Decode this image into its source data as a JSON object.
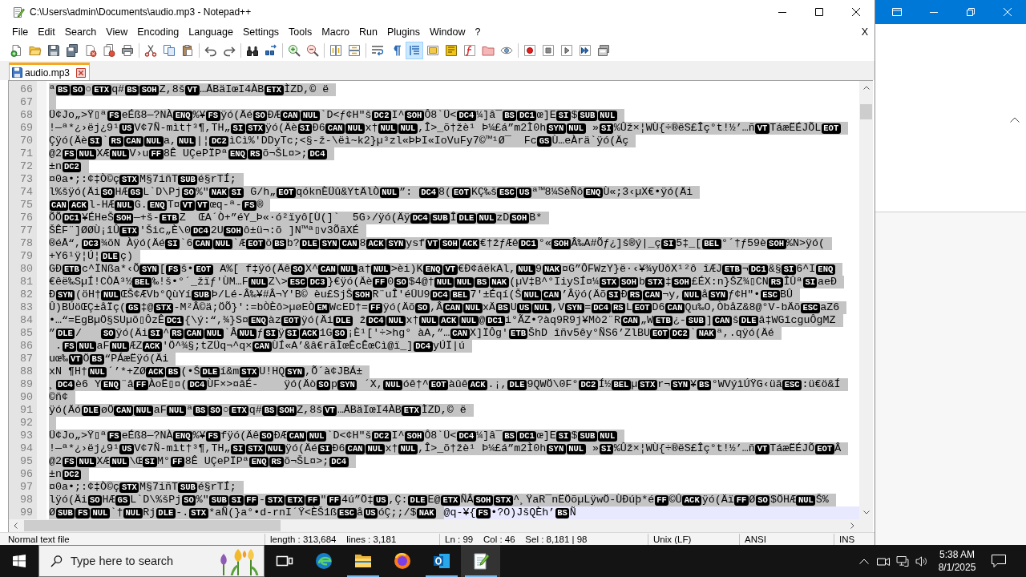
{
  "window": {
    "title": "C:\\Users\\admin\\Documents\\audio.mp3 - Notepad++"
  },
  "menu": [
    "File",
    "Edit",
    "Search",
    "View",
    "Encoding",
    "Language",
    "Settings",
    "Tools",
    "Macro",
    "Run",
    "Plugins",
    "Window",
    "?"
  ],
  "menu_close": "X",
  "toolbar": [
    [
      {
        "kind": "new",
        "on": false
      },
      {
        "kind": "open",
        "on": false
      },
      {
        "kind": "save",
        "on": false
      },
      {
        "kind": "save-all",
        "on": false
      },
      {
        "kind": "close",
        "on": false
      },
      {
        "kind": "close-all",
        "on": false
      },
      {
        "kind": "print",
        "on": false
      }
    ],
    [
      {
        "kind": "cut",
        "on": false
      },
      {
        "kind": "copy",
        "on": false
      },
      {
        "kind": "paste",
        "on": false
      }
    ],
    [
      {
        "kind": "undo",
        "on": false
      },
      {
        "kind": "redo",
        "on": false
      }
    ],
    [
      {
        "kind": "find",
        "on": false
      },
      {
        "kind": "replace",
        "on": false
      }
    ],
    [
      {
        "kind": "zoom-in",
        "on": false
      },
      {
        "kind": "zoom-out",
        "on": false
      }
    ],
    [
      {
        "kind": "sync-vertical",
        "on": false
      },
      {
        "kind": "sync-horizontal",
        "on": false
      }
    ],
    [
      {
        "kind": "word-wrap",
        "on": false
      },
      {
        "kind": "all-chars",
        "on": false
      },
      {
        "kind": "indent-guide",
        "on": true
      },
      {
        "kind": "language",
        "on": false
      },
      {
        "kind": "doc-map",
        "on": false
      },
      {
        "kind": "function-list",
        "on": false
      },
      {
        "kind": "folder-workspace",
        "on": false
      },
      {
        "kind": "monitoring",
        "on": false
      }
    ],
    [
      {
        "kind": "record",
        "on": false
      },
      {
        "kind": "stop",
        "on": false
      },
      {
        "kind": "play",
        "on": false
      },
      {
        "kind": "play-multiple",
        "on": false
      },
      {
        "kind": "save-macro",
        "on": false
      }
    ]
  ],
  "tabs": [
    {
      "label": "audio.mp3",
      "selected": true,
      "modified": false
    }
  ],
  "editor": {
    "lines": [
      {
        "number": "66",
        "selected": true,
        "current": false,
        "tokens": [
          "ª",
          {
            "control": "BS"
          },
          {
            "control": "SO"
          },
          "○",
          {
            "control": "ETX"
          },
          "q#",
          {
            "control": "BS"
          },
          {
            "control": "SOH"
          },
          "Z,8š",
          {
            "control": "VT"
          },
          "…ÅBäIœI4ÀB",
          {
            "control": "ETX"
          },
          "ÌZD,© ë"
        ]
      },
      {
        "number": "67",
        "selected": true,
        "current": false
      },
      {
        "number": "68",
        "selected": true,
        "current": false,
        "tokens": [
          "Ü¢Jo„>Ÿ▯ª",
          {
            "control": "FS"
          },
          "eÉß8—?NÀ",
          {
            "control": "ENQ"
          },
          "%¥",
          {
            "control": "FS"
          },
          "ÿó(Äé",
          {
            "control": "SO"
          },
          "ÐÆ",
          {
            "control": "CAN"
          },
          {
            "control": "NUL"
          },
          "`D<ƒ¢H\"š",
          {
            "control": "DC2"
          },
          "I^",
          {
            "control": "SOH"
          },
          "Ô8`Ü<",
          {
            "control": "DC4"
          },
          "¼]â¯",
          {
            "control": "BS"
          },
          {
            "control": "DC1"
          },
          "œ]E",
          {
            "control": "SI"
          },
          "$",
          {
            "control": "SUB"
          },
          {
            "control": "NUL"
          }
        ]
      },
      {
        "number": "69",
        "selected": true,
        "current": false,
        "tokens": [
          "!—ª*¿›ëj¿9¹",
          {
            "control": "US"
          },
          "V¢7Ñ-mìt†³¶,TH„",
          {
            "control": "SI"
          },
          {
            "control": "STX"
          },
          "ÿó(Äè",
          {
            "control": "SI"
          },
          "Ð6",
          {
            "control": "CAN"
          },
          {
            "control": "NUL"
          },
          "x†",
          {
            "control": "NUL"
          },
          {
            "control": "NUL"
          },
          ",Î>_õ†žè¹ Þ¼£á”m2Ì0h",
          {
            "control": "SYN"
          },
          {
            "control": "NUL"
          },
          " »",
          {
            "control": "SI"
          },
          "%Ûž×¦WÙ{÷®ëS£Îç°t!½’…ñ",
          {
            "control": "VT"
          },
          "TáæËÉJÕL",
          {
            "control": "EOT"
          }
        ]
      },
      {
        "number": "70",
        "selected": true,
        "current": false,
        "tokens": [
          "Çÿó(Äè",
          {
            "control": "SI"
          },
          "`",
          {
            "control": "RS"
          },
          {
            "control": "CAN"
          },
          {
            "control": "NUL"
          },
          "a,",
          {
            "control": "NUL"
          },
          "|¦",
          {
            "control": "DC2"
          },
          "ìCì%'DDyTc;<§-ž-\\ëì~k2}µ³zl«ÞÞI«IoVuFy7©™¹Ø¯  Fc",
          {
            "control": "GS"
          },
          "Ù…eÀrä`ÿó(Äç"
        ]
      },
      {
        "number": "71",
        "selected": true,
        "current": false,
        "tokens": [
          "@2",
          {
            "control": "FS"
          },
          {
            "control": "NUL"
          },
          "XÆ",
          {
            "control": "NUL"
          },
          "V›u",
          {
            "control": "FF"
          },
          "8Ê UÇePÏPª",
          {
            "control": "ENQ"
          },
          {
            "control": "RS"
          },
          "õ¬ŠL¤>;",
          {
            "control": "DC4"
          }
        ]
      },
      {
        "number": "72",
        "selected": true,
        "current": false,
        "tokens": [
          "±n",
          {
            "control": "DC2"
          }
        ]
      },
      {
        "number": "73",
        "selected": true,
        "current": false,
        "tokens": [
          "¤0a•;:¢‡Ò©ç",
          {
            "control": "STX"
          },
          "M§7iñT",
          {
            "control": "SUB"
          },
          "é§rTÍ;"
        ]
      },
      {
        "number": "74",
        "selected": true,
        "current": false,
        "tokens": [
          "l%šÿó(Äi",
          {
            "control": "SO"
          },
          "HÆ",
          {
            "control": "GS"
          },
          "L`D\\Pj",
          {
            "control": "SO"
          },
          "%\"",
          {
            "control": "NAK"
          },
          {
            "control": "SI"
          },
          " G/h„",
          {
            "control": "EOT"
          },
          "qóknÈÜû&YtÄlÒ",
          {
            "control": "NUL"
          },
          "”: ",
          {
            "control": "DC4"
          },
          "8(",
          {
            "control": "EOT"
          },
          "KÇ‰š",
          {
            "control": "ESC"
          },
          {
            "control": "US"
          },
          "ª™8¼SèÑô",
          {
            "control": "ENQ"
          },
          "Ù«;3‹µX€•ÿó(Äi"
        ]
      },
      {
        "number": "75",
        "selected": true,
        "current": false,
        "tokens": [
          {
            "control": "CAN"
          },
          {
            "control": "ACK"
          },
          "l-HÆ",
          {
            "control": "NUL"
          },
          "G.",
          {
            "control": "ENQ"
          },
          "T¤",
          {
            "control": "VT"
          },
          {
            "control": "VT"
          },
          "œq-ª-",
          {
            "control": "FS"
          },
          "®"
        ]
      },
      {
        "number": "76",
        "selected": true,
        "current": false,
        "tokens": [
          "ÕÕ",
          {
            "control": "DC1"
          },
          "¥ÉHeŠ",
          {
            "control": "SOH"
          },
          "—+š-",
          {
            "control": "ETB"
          },
          "Z  ŒA´Ò+”éY_Þ«·ó²ïyô[Ù(]`  5G›/ÿó(Äÿ",
          {
            "control": "DC4"
          },
          {
            "control": "SUB"
          },
          "Î",
          {
            "control": "DLE"
          },
          {
            "control": "NUL"
          },
          "zD",
          {
            "control": "SOH"
          },
          "B*"
        ]
      },
      {
        "number": "77",
        "selected": true,
        "current": false,
        "tokens": [
          "ŠÊF¨]ØØÙ¡îÛ",
          {
            "control": "ETX"
          },
          "'Šic„È\\0",
          {
            "control": "DC4"
          },
          "2U",
          {
            "control": "SOH"
          },
          "ô±ü¬:õ ]N™ª▯v3ÕãXÉ"
        ]
      },
      {
        "number": "78",
        "selected": true,
        "current": false,
        "tokens": [
          "®éÅ“,",
          {
            "control": "DC3"
          },
          "¾õN Àÿó(Äé",
          {
            "control": "SI"
          },
          "`6",
          {
            "control": "CAN"
          },
          {
            "control": "NUL"
          },
          "`Æ",
          {
            "control": "EOT"
          },
          "õ",
          {
            "control": "BS"
          },
          "b?",
          {
            "control": "DLE"
          },
          {
            "control": "SYN"
          },
          {
            "control": "CAN"
          },
          "8",
          {
            "control": "ACK"
          },
          {
            "control": "SYN"
          },
          "ysf",
          {
            "control": "VT"
          },
          {
            "control": "SOH"
          },
          {
            "control": "ACK"
          },
          "€†žƒÆê",
          {
            "control": "DC1"
          },
          "°«",
          {
            "control": "SOH"
          },
          "Â",
          "‰A#Õƒ¿]š®ý|_ç",
          {
            "control": "SI"
          },
          "5‡_[",
          {
            "control": "BEL"
          },
          "°´†ƒ59è",
          {
            "control": "SOH"
          },
          "%N>ÿó("
        ]
      },
      {
        "number": "79",
        "selected": true,
        "current": false,
        "tokens": [
          "+Y6¹ÿ¦Ú¦",
          {
            "control": "DLE"
          },
          "ç)"
        ]
      },
      {
        "number": "80",
        "selected": true,
        "current": false,
        "tokens": [
          "GÐ",
          {
            "control": "ETB"
          },
          "c^ÏNßa*‹Õ",
          {
            "control": "SYN"
          },
          "[",
          {
            "control": "FS"
          },
          "š•",
          {
            "control": "EOT"
          },
          " A%[ f‡ÿó(Äê",
          {
            "control": "SO"
          },
          "X^",
          {
            "control": "CAN"
          },
          {
            "control": "NUL"
          },
          "a†",
          {
            "control": "NUL"
          },
          ">èi)K",
          {
            "control": "ENQ"
          },
          {
            "control": "VT"
          },
          "€Ð¢áëkAl,",
          {
            "control": "NUL"
          },
          "9",
          {
            "control": "NAK"
          },
          "¤G”ÔFWzY}ë·‹¥¾yÜôX¹²ô îÆJ",
          {
            "control": "ETB"
          },
          "¬",
          {
            "control": "DC1"
          },
          "&§",
          {
            "control": "SI"
          },
          "6^I",
          {
            "control": "ENQ"
          }
        ]
      },
      {
        "number": "81",
        "selected": true,
        "current": false,
        "tokens": [
          "€êë‰SµÍ!CÒÅ³½",
          {
            "control": "BEL"
          },
          "‰!š•°´_žïƒ'ÙM…F",
          {
            "control": "NUL"
          },
          "Z\\>",
          {
            "control": "ESC"
          },
          {
            "control": "DC3"
          },
          "}€ÿó(Äè",
          {
            "control": "FF"
          },
          "0",
          {
            "control": "SO"
          },
          "$4@†",
          {
            "control": "NUL"
          },
          {
            "control": "NUL"
          },
          {
            "control": "BS"
          },
          {
            "control": "NAK"
          },
          "(µV‡B^°IiySÍ¤¼",
          {
            "control": "STX"
          },
          {
            "control": "SOH"
          },
          "b",
          {
            "control": "STX"
          },
          "‡",
          {
            "control": "SOH"
          },
          "£ÉX:n}ŠZ¾▯CN",
          {
            "control": "RS"
          },
          "ÎÛª",
          {
            "control": "SI"
          },
          "aeÐ"
        ]
      },
      {
        "number": "82",
        "selected": true,
        "current": false,
        "tokens": [
          "Ð",
          {
            "control": "SYN"
          },
          "(öH†",
          {
            "control": "NUL"
          },
          "ŒŠ¢ÆVb°QùYí",
          {
            "control": "SUB"
          },
          "Þ/Lé-Â",
          "‰¥#Â",
          "¬Y'B© èu£SjŠ",
          {
            "control": "SOH"
          },
          "R¨uÎ'éÜU9",
          {
            "control": "DC4"
          },
          {
            "control": "BEL"
          },
          "7'±Éqí(Š",
          {
            "control": "NUL"
          },
          {
            "control": "CAN"
          },
          "’Âÿó(Äõ",
          {
            "control": "SI"
          },
          "Ð",
          {
            "control": "RS"
          },
          {
            "control": "CAN"
          },
          "¬y,",
          {
            "control": "NUL"
          },
          "å",
          {
            "control": "SYN"
          },
          "ƒ¢H\"•",
          {
            "control": "ESC"
          },
          "BÛ"
        ]
      },
      {
        "number": "83",
        "selected": true,
        "current": false,
        "tokens": [
          "Û)BÚöŒÇ±åÏç(",
          {
            "control": "GS"
          },
          "‡@",
          {
            "control": "STX"
          },
          "-M²Â",
          "©ä;ÖÕ}':=bÒÈô>µøEÒ",
          {
            "control": "EM"
          },
          "WcED†=",
          {
            "control": "FF"
          },
          "ÿó(Äõ",
          {
            "control": "SO"
          },
          ",Â",
          {
            "control": "CAN"
          },
          {
            "control": "NUL"
          },
          "xÄ",
          {
            "control": "BS"
          },
          "U",
          {
            "control": "US"
          },
          {
            "control": "NUL"
          },
          ",V",
          {
            "control": "SYN"
          },
          "=",
          {
            "control": "DC4"
          },
          {
            "control": "RS"
          },
          "L",
          {
            "control": "EOT"
          },
          "D6",
          {
            "control": "CAN"
          },
          "Qu‰O,ÒbåZ&8@°V-bÄõ",
          {
            "control": "ESC"
          },
          "aZ6"
        ]
      },
      {
        "number": "84",
        "selected": true,
        "current": false,
        "tokens": [
          "•…“=EgBµÖ§SUµõ▯ÔzÊ",
          {
            "control": "DC1"
          },
          "{\\ý:“,¾}S¤",
          {
            "control": "ENQ"
          },
          "àz",
          {
            "control": "EOT"
          },
          "ÿó(Äi",
          {
            "control": "DLE"
          },
          " ž",
          {
            "control": "DC4"
          },
          {
            "control": "NUL"
          },
          "x†",
          {
            "control": "NUL"
          },
          {
            "control": "ACK"
          },
          {
            "control": "NUL"
          },
          "@",
          {
            "control": "DC1"
          },
          "i°ÃZ•?àq9R9j¥Mò2¨R",
          {
            "control": "CAN"
          },
          "„W",
          {
            "control": "ETB"
          },
          "¿-",
          {
            "control": "SUB"
          },
          "]",
          {
            "control": "CAN"
          },
          "š",
          {
            "control": "DLE"
          },
          "â‡WGîcguÔgMZ"
        ]
      },
      {
        "number": "85",
        "selected": true,
        "current": false,
        "tokens": [
          "”",
          {
            "control": "DLE"
          },
          "/   ",
          {
            "control": "SO"
          },
          "ÿó(Äi",
          {
            "control": "SI"
          },
          "^",
          {
            "control": "RS"
          },
          {
            "control": "CAN"
          },
          {
            "control": "NUL"
          },
          "`Â",
          {
            "control": "NUL"
          },
          "ƒ",
          {
            "control": "SI"
          },
          "ÿ",
          {
            "control": "SI"
          },
          {
            "control": "ACK"
          },
          "1G",
          {
            "control": "SO"
          },
          "¡È¹['÷>hg° àA,”…",
          {
            "control": "CAN"
          },
          "X]ÏÔg'",
          {
            "control": "ETB"
          },
          "ŠhD îñv5êy°ÑS6’ZlBU",
          {
            "control": "EOT"
          },
          {
            "control": "DC2"
          },
          "`",
          {
            "control": "NAK"
          },
          "ª,.qÿó(Äé"
        ]
      },
      {
        "number": "86",
        "selected": true,
        "current": false,
        "tokens": [
          " .",
          {
            "control": "FS"
          },
          {
            "control": "NUL"
          },
          "aF",
          {
            "control": "NUL"
          },
          "ÆZ",
          {
            "control": "ACK"
          },
          "'Ö^¾§;tZÜq¬^q×",
          {
            "control": "CAN"
          },
          "ÙÍ«A’&â",
          "€rãÌœÊcÊœCì@ï_]",
          {
            "control": "DC4"
          },
          "yÚÏ|ú"
        ]
      },
      {
        "number": "87",
        "selected": true,
        "current": false,
        "tokens": [
          "uœ‰",
          {
            "control": "VT"
          },
          "Ö",
          {
            "control": "BS"
          },
          "“PÁæËÿó(Äi"
        ]
      },
      {
        "number": "88",
        "selected": true,
        "current": false,
        "tokens": [
          "xN ¶H†",
          {
            "control": "NUL"
          },
          "´’*+ZØ",
          {
            "control": "ACK"
          },
          {
            "control": "BS"
          },
          "(•Š",
          {
            "control": "DLE"
          },
          "í&m",
          {
            "control": "STX"
          },
          "U!HQ",
          {
            "control": "SYN"
          },
          ",Õ´à¢JBÁ±"
        ]
      },
      {
        "number": "89",
        "selected": true,
        "current": false,
        "tokens": [
          "¸",
          {
            "control": "DC4"
          },
          "è6 Y",
          {
            "control": "ENQ"
          },
          "¨â",
          {
            "control": "FF"
          },
          "ÀoË▯¤(",
          {
            "control": "DC4"
          },
          "ÙF×>¤âÉ-    ÿó(Äò",
          {
            "control": "SO"
          },
          "p",
          {
            "control": "SYN"
          },
          " ´X,",
          {
            "control": "NUL"
          },
          "óê†^",
          {
            "control": "EOT"
          },
          "àûê",
          {
            "control": "ACK"
          },
          ".¡,",
          {
            "control": "DLE"
          },
          "9QWÖ\\0F°",
          {
            "control": "DC2"
          },
          "Í½",
          {
            "control": "BEL"
          },
          "µ",
          {
            "control": "STX"
          },
          "r¬",
          {
            "control": "SYN"
          },
          "¥",
          {
            "control": "BS"
          },
          "°WVýìÚŸG‹üã",
          {
            "control": "ESC"
          },
          ":ü€ö&Í"
        ]
      },
      {
        "number": "90",
        "selected": true,
        "current": false,
        "tokens": [
          "©ñ¢"
        ]
      },
      {
        "number": "91",
        "selected": true,
        "current": false,
        "tokens": [
          "ÿó(Äó",
          {
            "control": "DLE"
          },
          "øÖ",
          {
            "control": "CAN"
          },
          {
            "control": "NUL"
          },
          "aF",
          {
            "control": "NUL"
          },
          "ª",
          {
            "control": "BS"
          },
          {
            "control": "SO"
          },
          "○",
          {
            "control": "ETX"
          },
          "q#",
          {
            "control": "BS"
          },
          {
            "control": "SOH"
          },
          "Z,8š",
          {
            "control": "VT"
          },
          "…ÅBäIœI4ÀB",
          {
            "control": "ETX"
          },
          "ÌZD,© ë"
        ]
      },
      {
        "number": "92",
        "selected": true,
        "current": false
      },
      {
        "number": "93",
        "selected": true,
        "current": false,
        "tokens": [
          "Ü¢Jo„>Ÿ▯ª",
          {
            "control": "FS"
          },
          "eÉß8—?NÀ",
          {
            "control": "ENQ"
          },
          "%¥",
          {
            "control": "FS"
          },
          "fÿó(Äê",
          {
            "control": "SO"
          },
          "ÐÆ",
          {
            "control": "CAN"
          },
          {
            "control": "NUL"
          },
          "`D<¢H\"š",
          {
            "control": "DC2"
          },
          "I^",
          {
            "control": "SOH"
          },
          "Ô8`Ü<",
          {
            "control": "DC4"
          },
          "¼]â¯",
          {
            "control": "BS"
          },
          {
            "control": "DC1"
          },
          "œ]E",
          {
            "control": "SI"
          },
          "$",
          {
            "control": "SUB"
          },
          {
            "control": "NUL"
          }
        ]
      },
      {
        "number": "94",
        "selected": true,
        "current": false,
        "tokens": [
          "!—ª*¿›ëj¿9¹",
          {
            "control": "US"
          },
          "V¢7Ñ-mìt†³¶,TH„",
          {
            "control": "SI"
          },
          {
            "control": "STX"
          },
          {
            "control": "NUL"
          },
          "ÿó(Äé",
          {
            "control": "SI"
          },
          "Ð6",
          {
            "control": "CAN"
          },
          {
            "control": "NUL"
          },
          "x†",
          {
            "control": "NUL"
          },
          ",Î>_õ†žè¹ Þ¼£á”m2Ì0h",
          {
            "control": "SYN"
          },
          {
            "control": "NUL"
          },
          " »",
          {
            "control": "SI"
          },
          "%Ûž×¦WÙ{÷®ëS£Îç°t!½’…ñ",
          {
            "control": "VT"
          },
          "TáæËÉJÕ",
          {
            "control": "EOT"
          },
          "Â"
        ]
      },
      {
        "number": "95",
        "selected": true,
        "current": false,
        "tokens": [
          "@2",
          {
            "control": "FS"
          },
          {
            "control": "NUL"
          },
          "XÆ",
          {
            "control": "NUL"
          },
          "\\Œ",
          {
            "control": "SI"
          },
          "M°",
          {
            "control": "FF"
          },
          "8Ê UÇePÏPª",
          {
            "control": "ENQ"
          },
          {
            "control": "RS"
          },
          "õ¬ŠL¤>;",
          {
            "control": "DC4"
          }
        ]
      },
      {
        "number": "96",
        "selected": true,
        "current": false,
        "tokens": [
          "±n",
          {
            "control": "DC2"
          }
        ]
      },
      {
        "number": "97",
        "selected": true,
        "current": false,
        "tokens": [
          "¤0a•;:¢‡Ò©ç",
          {
            "control": "STX"
          },
          "M§7iñT",
          {
            "control": "SUB"
          },
          "é§rTÍ;"
        ]
      },
      {
        "number": "98",
        "selected": true,
        "current": false,
        "tokens": [
          "lÿó(Äi",
          {
            "control": "SO"
          },
          "HÆ",
          {
            "control": "GS"
          },
          "L`D\\%šPj",
          {
            "control": "SO"
          },
          "%\"",
          {
            "control": "SUB"
          },
          {
            "control": "SI"
          },
          {
            "control": "FF"
          },
          "-",
          {
            "control": "STX"
          },
          {
            "control": "ETX"
          },
          {
            "control": "FF"
          },
          "\"",
          {
            "control": "FF"
          },
          "4ú”Ö‡",
          {
            "control": "US"
          },
          ",Ç:",
          {
            "control": "DLE"
          },
          "E@",
          {
            "control": "ETX"
          },
          "ÑÂ",
          {
            "control": "SOH"
          },
          {
            "control": "STX"
          },
          "^¸ŸaR¯nËÖõµLÿwÖ-ÙÐúþ*é",
          {
            "control": "FF"
          },
          "©Û",
          {
            "control": "ACK"
          },
          "ÿó(Äï",
          {
            "control": "FF"
          },
          "Ø",
          {
            "control": "SO"
          },
          "$ÖHÆ",
          {
            "control": "NUL"
          },
          "Š%"
        ]
      },
      {
        "number": "99",
        "selected": true,
        "current": true,
        "tokens": [
          "Ø",
          {
            "control": "SUB"
          },
          {
            "control": "FS"
          },
          {
            "control": "NUL"
          },
          "`†",
          {
            "control": "NUL"
          },
          "Rj",
          {
            "control": "DLE"
          },
          "-.",
          {
            "control": "STX"
          },
          "*aÑ(}a°•d-rnI´Ÿ<ÈŠ1ß",
          {
            "control": "ESC"
          },
          "å",
          {
            "control": "US"
          },
          "óÇ;;/$",
          {
            "control": "NAK"
          }
        ],
        "unselected_tokens": [
          "@q-¥{",
          {
            "control": "FS"
          },
          "•?O)JšQÈh’",
          {
            "control": "BS"
          },
          "Ñ"
        ]
      }
    ]
  },
  "status_bar": [
    "Normal text file",
    "length : 313,684    lines : 3,181",
    "Ln : 99    Col : 46    Sel : 8,181 | 98",
    "Unix (LF)",
    "ANSI",
    "INS"
  ],
  "taskbar": {
    "search": {
      "placeholder": "Type here to search"
    },
    "apps": [
      {
        "kind": "task-view",
        "running": false,
        "active": false
      },
      {
        "kind": "edge",
        "running": false,
        "active": false
      },
      {
        "kind": "explorer",
        "running": true,
        "active": false
      },
      {
        "kind": "firefox",
        "running": false,
        "active": false
      },
      {
        "kind": "outlook",
        "running": true,
        "active": false
      },
      {
        "kind": "notepad-plus-plus",
        "running": true,
        "active": true
      }
    ],
    "clock": {
      "time": "5:38 AM",
      "date": "8/1/2025"
    }
  }
}
